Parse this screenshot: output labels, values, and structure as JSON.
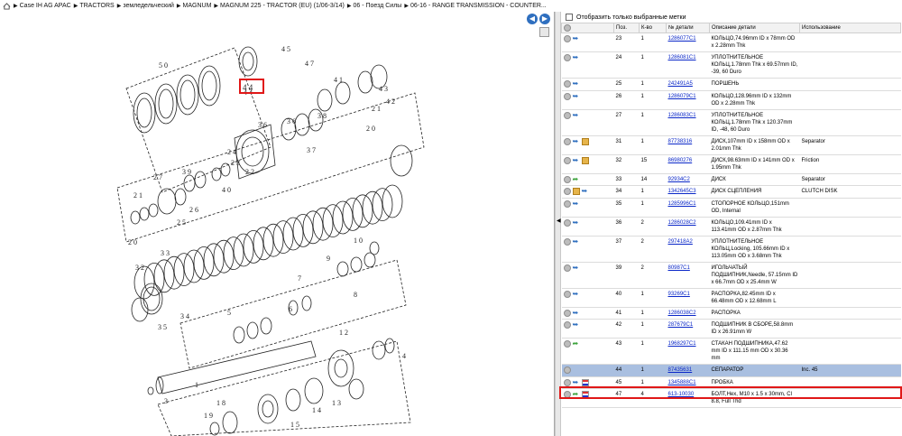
{
  "breadcrumb": [
    "Case IH AG APAC",
    "TRACTORS",
    "земледельческий",
    "MAGNUM",
    "MAGNUM 225 - TRACTOR (EU) (1/06-3/14)",
    "06 - Поезд Силы",
    "06-16 - RANGE TRANSMISSION - COUNTER..."
  ],
  "diagram": {
    "callout": "4 4",
    "labels": [
      "5 0",
      "4 5",
      "4 7",
      "4 4",
      "4 1",
      "4 3",
      "4 2",
      "3 8",
      "3 6",
      "2 1",
      "2 0",
      "3 7",
      "3 6",
      "2 4",
      "2 3",
      "2 2",
      "3 9",
      "4 0",
      "2 7",
      "2 1",
      "2 6",
      "2 5",
      "2 0",
      "3 3",
      "3 2",
      "3 4",
      "3 5",
      "1 0",
      "9",
      "8",
      "7",
      "6",
      "5",
      "1",
      "3",
      "1 8",
      "1 9",
      "1 5",
      "1 4",
      "1 3",
      "1 2",
      "4"
    ]
  },
  "filter": {
    "label": "Отобразить только выбранные метки"
  },
  "table": {
    "headers": {
      "pos": "Поз.",
      "qty": "К-во",
      "part": "№ детали",
      "desc": "Описание детали",
      "usage": "Использование"
    },
    "rows": [
      {
        "pos": "23",
        "qty": "1",
        "part": "1286077C1",
        "desc": "КОЛЬЦО,74.96mm ID x 78mm OD x 2.28mm Thk",
        "usage": "",
        "icons": [
          "circle",
          "blue"
        ]
      },
      {
        "pos": "24",
        "qty": "1",
        "part": "1286081C1",
        "desc": "УПЛОТНИТЕЛЬНОЕ КОЛЬЦ,1.78mm Thk x 69.57mm ID, -39, 60 Duro",
        "usage": "",
        "icons": [
          "circle",
          "blue"
        ]
      },
      {
        "pos": "25",
        "qty": "1",
        "part": "242491A5",
        "desc": "ПОРШЕНЬ",
        "usage": "",
        "icons": [
          "circle",
          "blue"
        ]
      },
      {
        "pos": "26",
        "qty": "1",
        "part": "1286079C1",
        "desc": "КОЛЬЦО,128.96mm ID x 132mm OD x 2.28mm Thk",
        "usage": "",
        "icons": [
          "circle",
          "blue"
        ]
      },
      {
        "pos": "27",
        "qty": "1",
        "part": "1286083C1",
        "desc": "УПЛОТНИТЕЛЬНОЕ КОЛЬЦ,1.78mm Thk x 120.37mm ID, -48, 60 Duro",
        "usage": "",
        "icons": [
          "circle",
          "blue"
        ]
      },
      {
        "pos": "31",
        "qty": "1",
        "part": "87738316",
        "desc": "ДИСК,107mm ID x 158mm OD x 2.01mm Thk",
        "usage": "Separator",
        "icons": [
          "circle",
          "blue",
          "box"
        ]
      },
      {
        "pos": "32",
        "qty": "15",
        "part": "86980276",
        "desc": "ДИСК,98.63mm ID x 141mm OD x 1.95mm Thk",
        "usage": "Friction",
        "icons": [
          "circle",
          "blue",
          "box"
        ]
      },
      {
        "pos": "33",
        "qty": "14",
        "part": "92934C2",
        "desc": "ДИСК",
        "usage": "Separator",
        "icons": [
          "circle",
          "green"
        ]
      },
      {
        "pos": "34",
        "qty": "1",
        "part": "1342645C3",
        "desc": "ДИСК СЦЕПЛЕНИЯ",
        "usage": "CLUTCH DISK",
        "icons": [
          "circle",
          "box",
          "blue"
        ]
      },
      {
        "pos": "35",
        "qty": "1",
        "part": "1285996C1",
        "desc": "СТОПОРНОЕ КОЛЬЦО,151mm OD, Internal",
        "usage": "",
        "icons": [
          "circle",
          "blue"
        ]
      },
      {
        "pos": "36",
        "qty": "2",
        "part": "1286028C2",
        "desc": "КОЛЬЦО,109.41mm ID x 113.41mm OD x 2.87mm Thk",
        "usage": "",
        "icons": [
          "circle",
          "blue"
        ]
      },
      {
        "pos": "37",
        "qty": "2",
        "part": "297418A2",
        "desc": "УПЛОТНИТЕЛЬНОЕ КОЛЬЦ,Locking, 105.66mm ID x 113.05mm OD x 3.68mm Thk",
        "usage": "",
        "icons": [
          "circle",
          "blue"
        ]
      },
      {
        "pos": "39",
        "qty": "2",
        "part": "80987C1",
        "desc": "ИГОЛЬЧАТЫЙ ПОДШИПНИК,Needle, 57.15mm ID x 66.7mm OD x 25.4mm W",
        "usage": "",
        "icons": [
          "circle",
          "blue"
        ]
      },
      {
        "pos": "40",
        "qty": "1",
        "part": "93269C1",
        "desc": "РАСПОРКА,82.45mm ID x 66.48mm OD x 12.68mm L",
        "usage": "",
        "icons": [
          "circle",
          "blue"
        ]
      },
      {
        "pos": "41",
        "qty": "1",
        "part": "1286038C2",
        "desc": "РАСПОРКА",
        "usage": "",
        "icons": [
          "circle",
          "blue"
        ]
      },
      {
        "pos": "42",
        "qty": "1",
        "part": "287679C1",
        "desc": "ПОДШИПНИК В СБОРЕ,58.8mm ID x 26.91mm W",
        "usage": "",
        "icons": [
          "circle",
          "blue"
        ]
      },
      {
        "pos": "43",
        "qty": "1",
        "part": "1968297C1",
        "desc": "СТАКАН ПОДШИПНИКА,47.62 mm ID x 111.15 mm OD x 30.36 mm",
        "usage": "",
        "icons": [
          "circle",
          "green"
        ]
      },
      {
        "pos": "44",
        "qty": "1",
        "part": "87435631",
        "desc": "СЕПАРАТОР",
        "usage": "Inc. 45",
        "icons": [
          "circle"
        ],
        "selected": true
      },
      {
        "pos": "45",
        "qty": "1",
        "part": "1345888C1",
        "desc": "ПРОБКА",
        "usage": "",
        "icons": [
          "circle",
          "blue",
          "flag"
        ]
      },
      {
        "pos": "47",
        "qty": "4",
        "part": "613-10030",
        "desc": "БОЛТ,Hex, M10 x 1.5 x 30mm, Cl 8.8, Full Thd",
        "usage": "",
        "icons": [
          "circle",
          "green",
          "flag"
        ]
      }
    ]
  },
  "colors": {
    "link": "#0a27c8",
    "highlight": "#e01818",
    "selected_row": "#a9bfe0"
  }
}
